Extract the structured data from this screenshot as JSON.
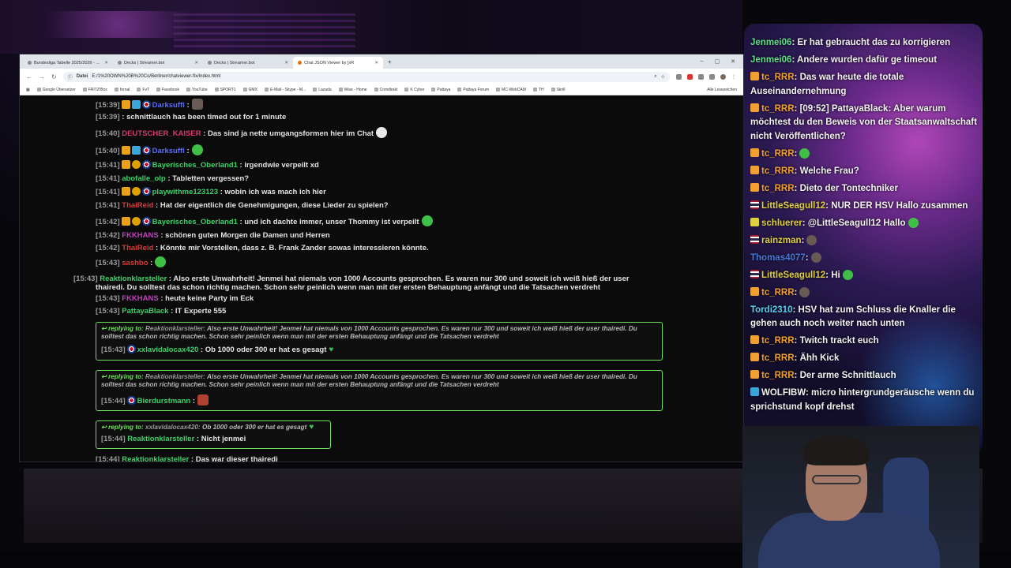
{
  "browser": {
    "tabs": [
      {
        "label": "Bundesliga Tabelle 2025/2026 - ..."
      },
      {
        "label": "Decks | Streamer.bot"
      },
      {
        "label": "Decks | Streamer.bot"
      },
      {
        "label": "Chat JSON Viewer by [xR"
      }
    ],
    "new_tab": "+",
    "address_label": "Datei",
    "url": "E:/1%20OWN%20B%20Co/Berliner/chatviewer-fix/index.html",
    "bookmarks": [
      "Google Übersetzer",
      "FRITZ!Box",
      "fornal",
      "FvT",
      "Facebook",
      "YouTube",
      "SPORT1",
      "GMX",
      "E-Mail - Skype - M...",
      "Lazada",
      "Wise - Home",
      "Comdirekt",
      "K Cyber",
      "Pattaya",
      "Pattaya Forum",
      "MC-WebCAM",
      "TH",
      "Skrill"
    ],
    "bookmarks_all": "Alle Lesezeichen"
  },
  "chat": {
    "messages": [
      {
        "ts": "[15:39]",
        "user": "Darksuffi",
        "color": "#5b6cff",
        "text": ":"
      },
      {
        "ts": "[15:39]",
        "user": "",
        "color": "#e4e4e4",
        "text": ": schnittlauch has been timed out for 1 minute"
      },
      {
        "ts": "[15:40]",
        "user": "DEUTSCHER_KAISER",
        "color": "#d63a6a",
        "text": ": Das sind ja nette umgangsformen hier im Chat"
      },
      {
        "ts": "[15:40]",
        "user": "Darksuffi",
        "color": "#5b6cff",
        "text": ":"
      },
      {
        "ts": "[15:41]",
        "user": "Bayerisches_Oberland1",
        "color": "#3fd06a",
        "text": ": irgendwie verpeilt xd"
      },
      {
        "ts": "[15:41]",
        "user": "abofalle_olp",
        "color": "#3fd06a",
        "text": ": Tabletten vergessen?"
      },
      {
        "ts": "[15:41]",
        "user": "playwithme123123",
        "color": "#3fd06a",
        "text": ": wobin ich was mach ich hier"
      },
      {
        "ts": "[15:41]",
        "user": "ThaiReid",
        "color": "#d63a3a",
        "text": ": Hat der eigentlich die Genehmigungen, diese Lieder zu spielen?"
      },
      {
        "ts": "[15:42]",
        "user": "Bayerisches_Oberland1",
        "color": "#3fd06a",
        "text": ": und ich dachte immer, unser Thommy ist verpeilt"
      },
      {
        "ts": "[15:42]",
        "user": "FKKHANS",
        "color": "#c040c0",
        "text": ": schönen guten Morgen die Damen und Herren"
      },
      {
        "ts": "[15:42]",
        "user": "ThaiReid",
        "color": "#d63a3a",
        "text": ": Könnte mir Vorstellen, dass z. B. Frank Zander sowas interessieren könnte."
      },
      {
        "ts": "[15:43]",
        "user": "sashbo",
        "color": "#d63a3a",
        "text": ":"
      },
      {
        "ts": "[15:43]",
        "user": "Reaktionklarsteller",
        "color": "#3fd06a",
        "text": ": Also erste Unwahrheit! Jenmei hat niemals von 1000 Accounts gesprochen. Es waren nur 300 und soweit ich weiß hieß der user thairedi. Du solltest das schon richtig machen. Schon sehr peinlich wenn man mit der ersten Behauptung anfängt und die Tatsachen verdreht"
      },
      {
        "ts": "[15:43]",
        "user": "FKKHANS",
        "color": "#c040c0",
        "text": ": heute keine Party im Eck"
      },
      {
        "ts": "[15:43]",
        "user": "PattayaBlack",
        "color": "#3fd06a",
        "text": ": IT Experte 555"
      }
    ],
    "replies": [
      {
        "label": "replying to:",
        "ref_user": "Reaktionklarsteller:",
        "ref_text": "Also erste Unwahrheit! Jenmei hat niemals von 1000 Accounts gesprochen. Es waren nur 300 und soweit ich weiß hieß der user thairedi. Du solltest das schon richtig machen. Schon sehr peinlich wenn man mit der ersten Behauptung anfängt und die Tatsachen verdreht",
        "ts": "[15:43]",
        "user": "xxlavidalocax420",
        "color": "#3fd06a",
        "text": ": Ob 1000 oder 300 er hat es gesagt"
      },
      {
        "label": "replying to:",
        "ref_user": "Reaktionklarsteller:",
        "ref_text": "Also erste Unwahrheit! Jenmei hat niemals von 1000 Accounts gesprochen. Es waren nur 300 und soweit ich weiß hieß der user thairedi. Du solltest das schon richtig machen. Schon sehr peinlich wenn man mit der ersten Behauptung anfängt und die Tatsachen verdreht",
        "ts": "[15:44]",
        "user": "Bierdurstmann",
        "color": "#3fd06a",
        "text": ":"
      },
      {
        "label": "replying to:",
        "ref_user": "xxlavidalocax420:",
        "ref_text": "Ob 1000 oder 300 er hat es gesagt",
        "ts": "[15:44]",
        "user": "Reaktionklarsteller",
        "color": "#3fd06a",
        "text": ": Nicht jenmei"
      }
    ],
    "last": {
      "ts": "[15:44]",
      "user": "Reaktionklarsteller",
      "color": "#3fd06a",
      "text": ": Das war dieser thairedi"
    }
  },
  "overlay": {
    "messages": [
      {
        "user": "Jenmei06",
        "color": "#5fe08a",
        "text": ": Er hat gebraucht das zu korrigieren"
      },
      {
        "user": "Jenmei06",
        "color": "#5fe08a",
        "text": ": Andere wurden dafür ge timeout"
      },
      {
        "user": "tc_RRR",
        "color": "#f0a030",
        "text": ": Das war heute die totale Auseinandernehmung"
      },
      {
        "user": "tc_RRR",
        "color": "#f0a030",
        "text": ": [09:52] PattayaBlack: Aber warum möchtest du den Beweis von der Staatsanwaltschaft nicht Veröffentlichen?"
      },
      {
        "user": "tc_RRR",
        "color": "#f0a030",
        "text": ":"
      },
      {
        "user": "tc_RRR",
        "color": "#f0a030",
        "text": ": Welche Frau?"
      },
      {
        "user": "tc_RRR",
        "color": "#f0a030",
        "text": ": Dieto der Tontechniker"
      },
      {
        "user": "LittleSeagull12",
        "color": "#e0d040",
        "text": ": NUR DER HSV Hallo zusammen"
      },
      {
        "user": "schluerer",
        "color": "#e0d040",
        "text": ": @LittleSeagull12 Hallo"
      },
      {
        "user": "rainzman",
        "color": "#e0d040",
        "text": ":"
      },
      {
        "user": "Thomas4077",
        "color": "#4a7ad8",
        "text": ":"
      },
      {
        "user": "LittleSeagull12",
        "color": "#e0d040",
        "text": ": Hi"
      },
      {
        "user": "tc_RRR",
        "color": "#f0a030",
        "text": ":"
      },
      {
        "user": "Tordi2310",
        "color": "#5ad0f0",
        "text": ": HSV hat zum Schluss die Knaller die gehen auch noch weiter nach unten"
      },
      {
        "user": "tc_RRR",
        "color": "#f0a030",
        "text": ": Twitch trackt euch"
      },
      {
        "user": "tc_RRR",
        "color": "#f0a030",
        "text": ": Ähh Kick"
      },
      {
        "user": "tc_RRR",
        "color": "#f0a030",
        "text": ": Der arme Schnittlauch"
      },
      {
        "user": "WOLFIBW",
        "color": "#f2f2f2",
        "text": ": micro hintergrundgeräusche wenn du sprichstund kopf drehst"
      }
    ]
  }
}
